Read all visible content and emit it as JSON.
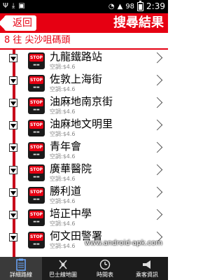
{
  "status_bar": {
    "signal": "98",
    "time": "2:39",
    "left_icons": [
      "usb-icon",
      "download-icon",
      "notification-icon"
    ]
  },
  "header": {
    "back_label": "返回",
    "title": "搜尋結果"
  },
  "route": {
    "label": "8 往 尖沙咀碼頭"
  },
  "stops": [
    {
      "name": "九龍鐵路站",
      "fare": "空調:$4.6",
      "sign": "STOP"
    },
    {
      "name": "佐敦上海街",
      "fare": "空調:$4.6",
      "sign": "STOP"
    },
    {
      "name": "油麻地南京街",
      "fare": "空調:$4.6",
      "sign": "STOP"
    },
    {
      "name": "油麻地文明里",
      "fare": "空調:$4.6",
      "sign": "STOP"
    },
    {
      "name": "青年會",
      "fare": "空調:$4.6",
      "sign": "STOP"
    },
    {
      "name": "廣華醫院",
      "fare": "空調:$4.6",
      "sign": "STOP"
    },
    {
      "name": "勝利道",
      "fare": "空調:$4.6",
      "sign": "STOP"
    },
    {
      "name": "培正中學",
      "fare": "空調:$4.6",
      "sign": "STOP"
    },
    {
      "name": "何文田警署",
      "fare": "空調:$4.6",
      "sign": "STOP"
    }
  ],
  "watermark": "www.android-apk.com",
  "tabs": [
    {
      "label": "詳細路線",
      "icon": "clipboard-icon",
      "active": true
    },
    {
      "label": "巴士線地圖",
      "icon": "map-pin-icon",
      "active": false
    },
    {
      "label": "時間表",
      "icon": "clock-icon",
      "active": false
    },
    {
      "label": "乘客資訊",
      "icon": "megaphone-icon",
      "active": false
    }
  ]
}
